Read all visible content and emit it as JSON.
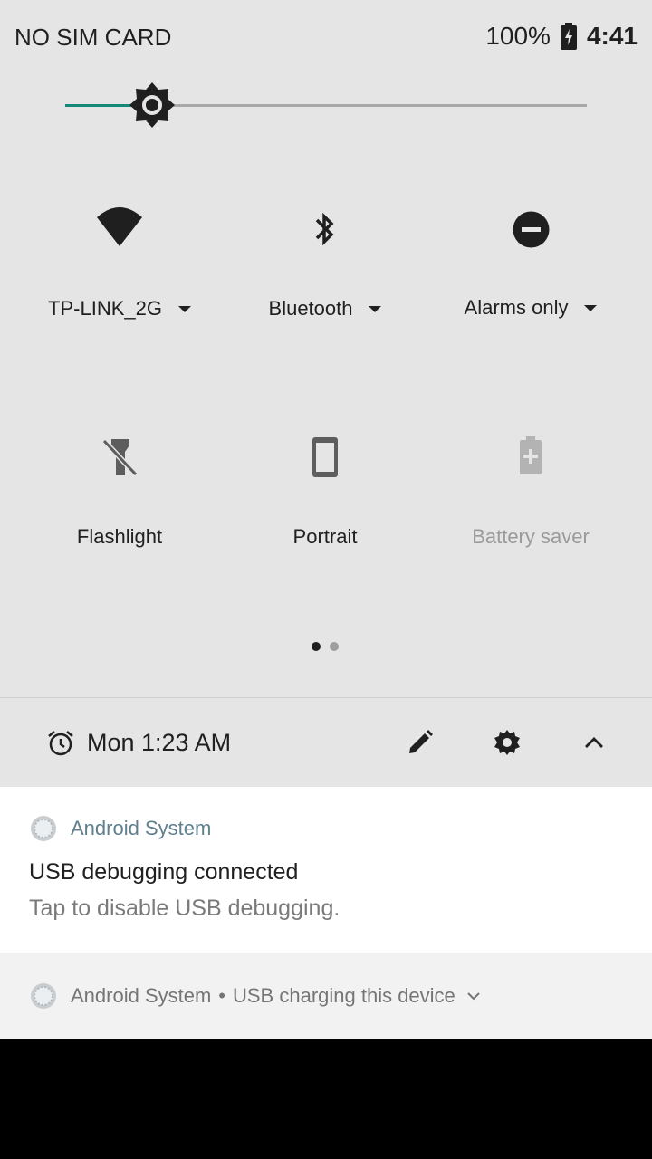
{
  "status_bar": {
    "carrier": "NO SIM CARD",
    "battery": "100%",
    "time": "4:41"
  },
  "brightness": {
    "level": 0.167,
    "accent": "#14897a"
  },
  "tiles": [
    {
      "label": "TP-LINK_2G",
      "icon": "wifi-icon",
      "has_dropdown": true
    },
    {
      "label": "Bluetooth",
      "icon": "bluetooth-icon",
      "has_dropdown": true
    },
    {
      "label": "Alarms only",
      "icon": "do-not-disturb-icon",
      "has_dropdown": true
    },
    {
      "label": "Flashlight",
      "icon": "flashlight-off-icon",
      "has_dropdown": false
    },
    {
      "label": "Portrait",
      "icon": "portrait-icon",
      "has_dropdown": false
    },
    {
      "label": "Battery saver",
      "icon": "battery-saver-icon",
      "has_dropdown": false,
      "disabled": true
    }
  ],
  "pager": {
    "pages": 2,
    "current": 1
  },
  "footer": {
    "alarm_text": "Mon 1:23 AM"
  },
  "notifications": [
    {
      "app": "Android System",
      "title": "USB debugging connected",
      "body": "Tap to disable USB debugging."
    },
    {
      "app": "Android System",
      "summary": "USB charging this device"
    }
  ],
  "separator": "•"
}
